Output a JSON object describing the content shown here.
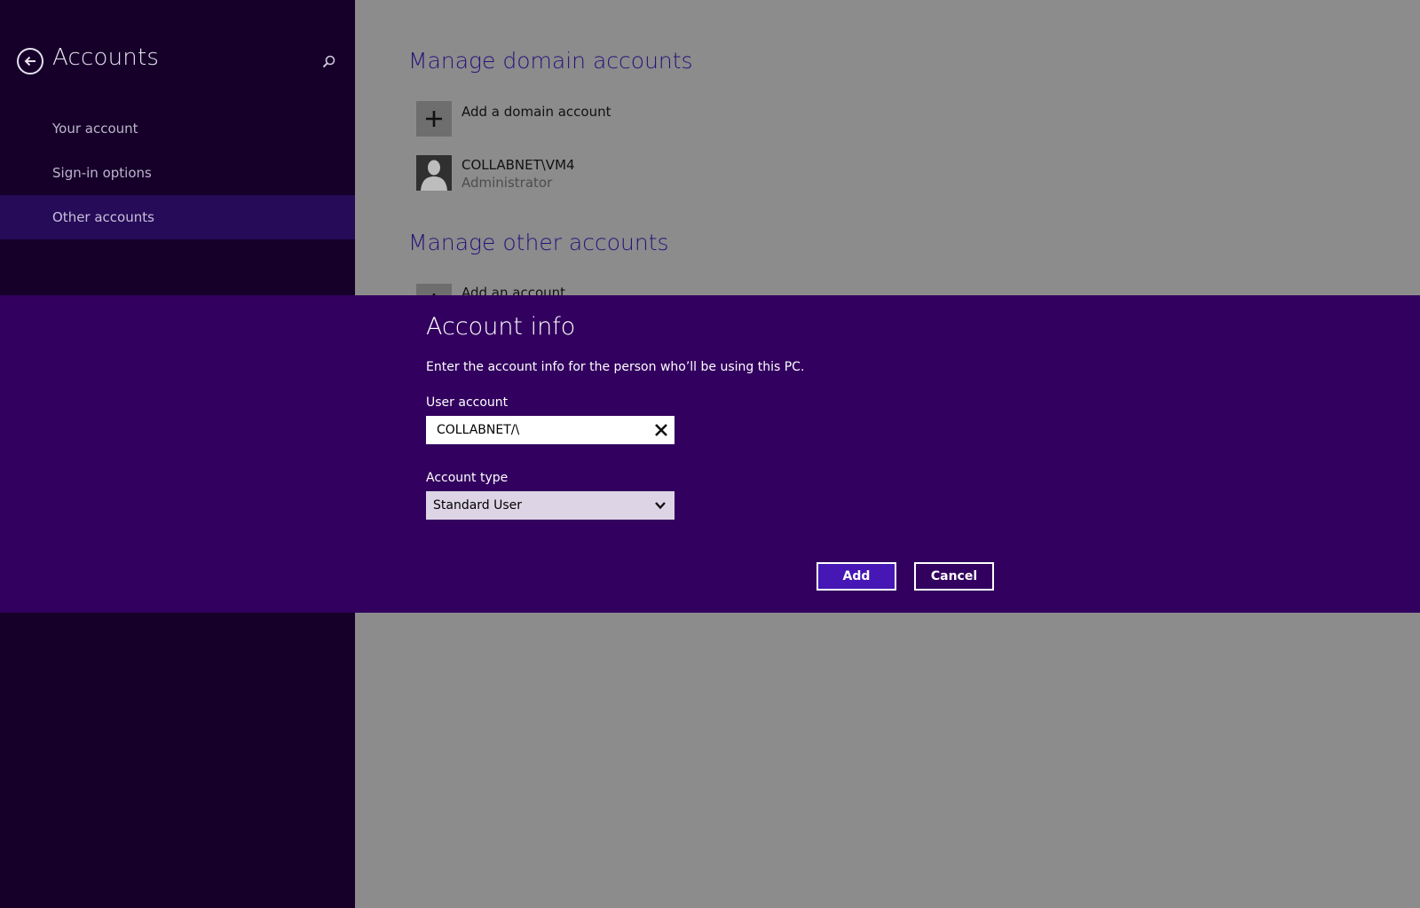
{
  "sidebar": {
    "title": "Accounts",
    "back_icon": "back-arrow-circle-icon",
    "search_icon": "search-icon",
    "items": [
      {
        "label": "Your account",
        "selected": false
      },
      {
        "label": "Sign-in options",
        "selected": false
      },
      {
        "label": "Other accounts",
        "selected": true
      }
    ]
  },
  "main": {
    "domain_section": {
      "title": "Manage domain accounts",
      "add_label": "Add a domain account",
      "account": {
        "name": "COLLABNET\\VM4",
        "role": "Administrator"
      }
    },
    "other_section": {
      "title": "Manage other accounts",
      "add_label": "Add an account"
    }
  },
  "dialog": {
    "title": "Account info",
    "description": "Enter the account info for the person who’ll be using this PC.",
    "user_account_label": "User account",
    "user_account_value": "COLLABNET/\\",
    "account_type_label": "Account type",
    "account_type_value": "Standard User",
    "add_button": "Add",
    "cancel_button": "Cancel"
  },
  "colors": {
    "sidebar_bg": "#16002a",
    "selected_item_bg": "#260b58",
    "dialog_bg": "#32005f",
    "accent_button": "#4617b4",
    "heading_text": "#28127a",
    "dimmed_content_bg": "#8c8c8c"
  }
}
